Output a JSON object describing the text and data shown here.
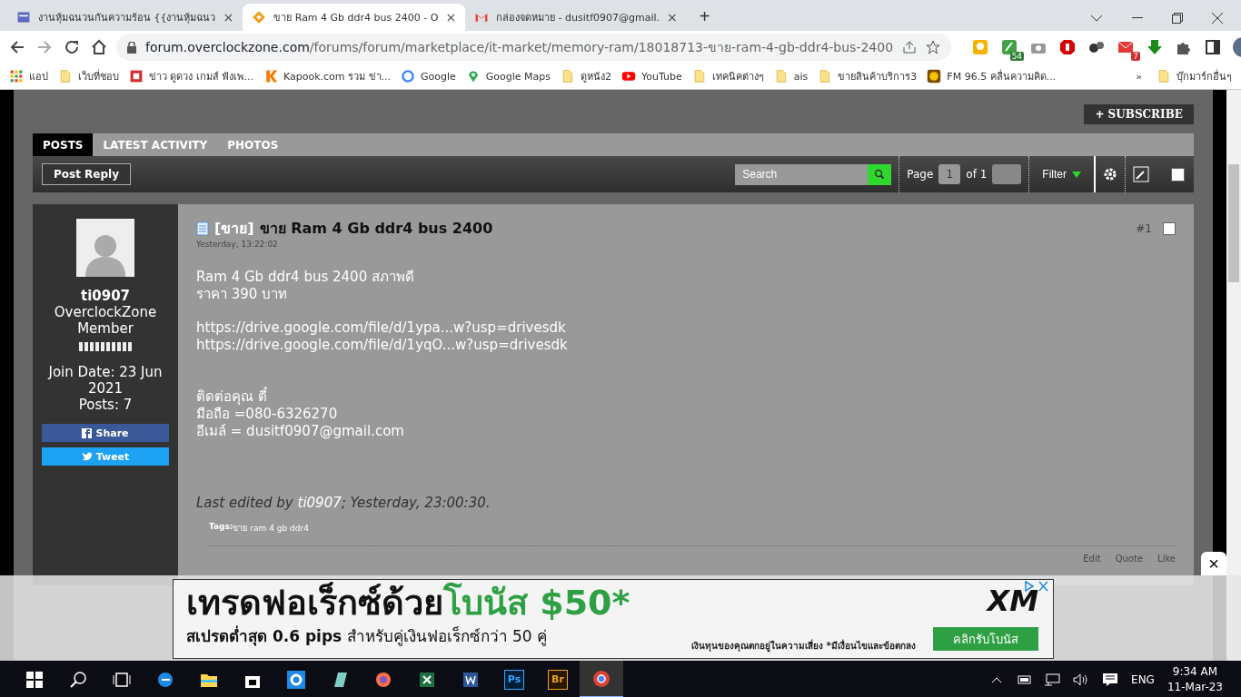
{
  "browser": {
    "tabs": [
      {
        "title": "งานหุ้มฉนวนกันความร้อน {{งานหุ้มฉนว",
        "selected": false,
        "kind": "site",
        "close": "×"
      },
      {
        "title": "ขาย Ram 4 Gb ddr4 bus 2400 - O",
        "selected": true,
        "kind": "forum",
        "close": "×"
      },
      {
        "title": "กล่องจดหมาย - dusitf0907@gmail.",
        "selected": false,
        "kind": "mail",
        "close": "×"
      }
    ],
    "new_tab": "+",
    "url_host": "forum.overclockzone.com",
    "url_path": "/forums/forum/marketplace/it-market/memory-ram/18018713-ขาย-ram-4-gb-ddr4-bus-2400",
    "extensions": [
      {
        "kind": "note"
      },
      {
        "kind": "pen",
        "badge": "54"
      },
      {
        "kind": "camera"
      },
      {
        "kind": "stop"
      },
      {
        "kind": "balls"
      },
      {
        "kind": "mail",
        "badge": "7"
      },
      {
        "kind": "download"
      },
      {
        "kind": "puzzle"
      },
      {
        "kind": "panel"
      }
    ],
    "bookmarks": [
      {
        "kind": "apps",
        "label": "แอป"
      },
      {
        "kind": "folder",
        "label": "เว็บที่ชอบ"
      },
      {
        "kind": "s",
        "label": "ข่าว ดูดวง เกมส์ ฟังเพ..."
      },
      {
        "kind": "k",
        "label": "Kapook.com รวม ข่า..."
      },
      {
        "kind": "g",
        "label": "Google"
      },
      {
        "kind": "maps",
        "label": "Google Maps"
      },
      {
        "kind": "folder",
        "label": "ดูหนัง2"
      },
      {
        "kind": "yt",
        "label": "YouTube"
      },
      {
        "kind": "folder",
        "label": "เทคนิคต่างๆ"
      },
      {
        "kind": "folder",
        "label": "ais"
      },
      {
        "kind": "folder",
        "label": "ขายสินค้าบริการ3"
      },
      {
        "kind": "fm",
        "label": "FM 96.5 คลื่นความคิด..."
      }
    ],
    "more": "»",
    "other_bookmarks": "บุ๊กมาร์กอื่นๆ"
  },
  "forum": {
    "subscribe": "+ SUBSCRIBE",
    "tabs": [
      {
        "label": "POSTS",
        "selected": true
      },
      {
        "label": "LATEST ACTIVITY",
        "selected": false
      },
      {
        "label": "PHOTOS",
        "selected": false
      }
    ],
    "post_reply": "Post Reply",
    "search_placeholder": "Search",
    "page_label": "Page",
    "page_value": "1",
    "page_of": "of 1",
    "filter": "Filter",
    "select_all_checked": false,
    "post": {
      "username": "ti0907",
      "user_title": "OverclockZone Member",
      "join_date": "Join Date: 23 Jun 2021",
      "posts": "Posts: 7",
      "share": "Share",
      "tweet": "Tweet",
      "prefix": "[ขาย]",
      "checked": false,
      "title": "ขาย Ram 4 Gb ddr4 bus 2400",
      "date": "Yesterday, 13:22:02",
      "number": "#1",
      "body": [
        {
          "kind": "text",
          "lines": [
            "Ram 4 Gb ddr4 bus 2400 สภาพดี",
            "ราคา 390 บาท"
          ]
        },
        {
          "kind": "link",
          "lines": [
            "https://drive.google.com/file/d/1ypa...w?usp=drivesdk",
            "https://drive.google.com/file/d/1yqO...w?usp=drivesdk"
          ]
        },
        {
          "kind": "text",
          "lines": [
            "ติดต่อคุณ ตี๋",
            "มือถือ =080-6326270",
            "อีเมล์ = dusitf0907@gmail.com"
          ]
        }
      ],
      "edited_prefix": "Last edited by",
      "edited_user": "ti0907",
      "edited_suffix": "; Yesterday, 23:00:30.",
      "tags_label": "Tags:",
      "tags": "ขาย ram 4 gb ddr4",
      "actions": [
        "Edit",
        "Quote",
        "Like"
      ]
    }
  },
  "ad": {
    "headline": "เทรดฟอเร็กซ์ด้วย",
    "headline_highlight": "โบนัส $50*",
    "subline": "**สเปรดต่ำสุด 0.6 pips** สำหรับคู่เงินฟอเร็กซ์กว่า 50 คู่",
    "disclaimer": "เงินทุนของคุณตกอยู่ในความเสี่ยง *มีเงื่อนไขและข้อตกลง",
    "logo": "XM",
    "cta": "คลิกรับโบนัส",
    "close": "×"
  },
  "taskbar": {
    "apps": [
      {
        "kind": "start"
      },
      {
        "kind": "search"
      },
      {
        "kind": "taskview"
      },
      {
        "kind": "edge"
      },
      {
        "kind": "folder"
      },
      {
        "kind": "store"
      },
      {
        "kind": "settings"
      },
      {
        "kind": "notepad"
      },
      {
        "kind": "fox"
      },
      {
        "kind": "excel"
      },
      {
        "kind": "word"
      },
      {
        "kind": "ps",
        "label": "Ps"
      },
      {
        "kind": "br",
        "label": "Br"
      },
      {
        "kind": "chrome",
        "selected": true
      }
    ],
    "lang": "ENG",
    "time": "9:34 AM",
    "date": "11-Mar-23"
  }
}
